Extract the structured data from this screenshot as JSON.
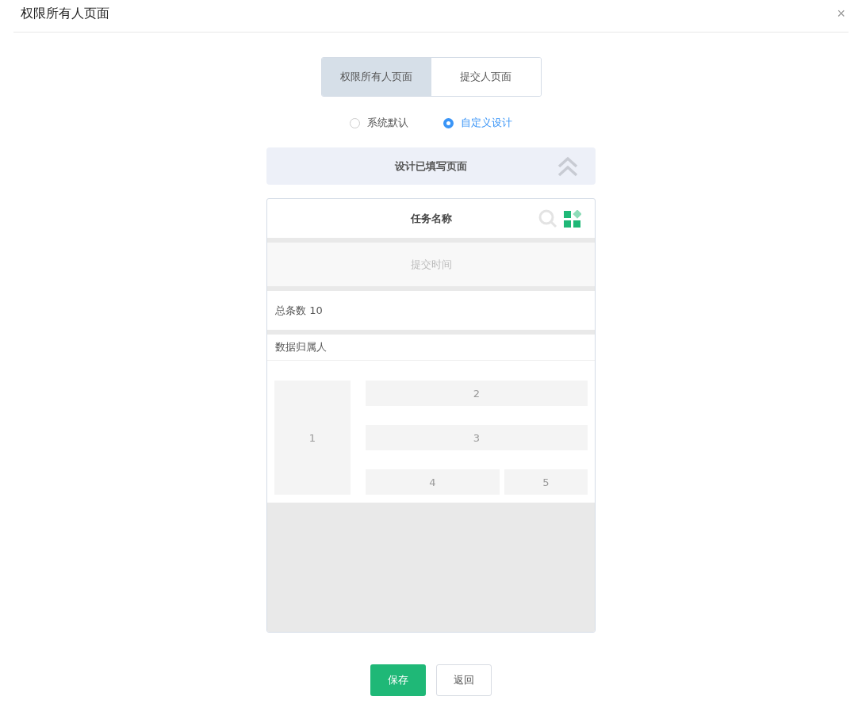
{
  "dialog": {
    "title": "权限所有人页面",
    "close": "×"
  },
  "tabs": [
    {
      "label": "权限所有人页面",
      "selected": true
    },
    {
      "label": "提交人页面",
      "selected": false
    }
  ],
  "radios": [
    {
      "label": "系统默认",
      "selected": false
    },
    {
      "label": "自定义设计",
      "selected": true
    }
  ],
  "design_bar": {
    "title": "设计已填写页面",
    "expanded": true
  },
  "preview": {
    "header": "任务名称",
    "filter": "提交时间",
    "total": "总条数 10",
    "owner": "数据归属人",
    "layout_cells": [
      "1",
      "2",
      "3",
      "4",
      "5"
    ]
  },
  "buttons": [
    {
      "label": "保存",
      "kind": "primary"
    },
    {
      "label": "返回",
      "kind": "default"
    }
  ]
}
